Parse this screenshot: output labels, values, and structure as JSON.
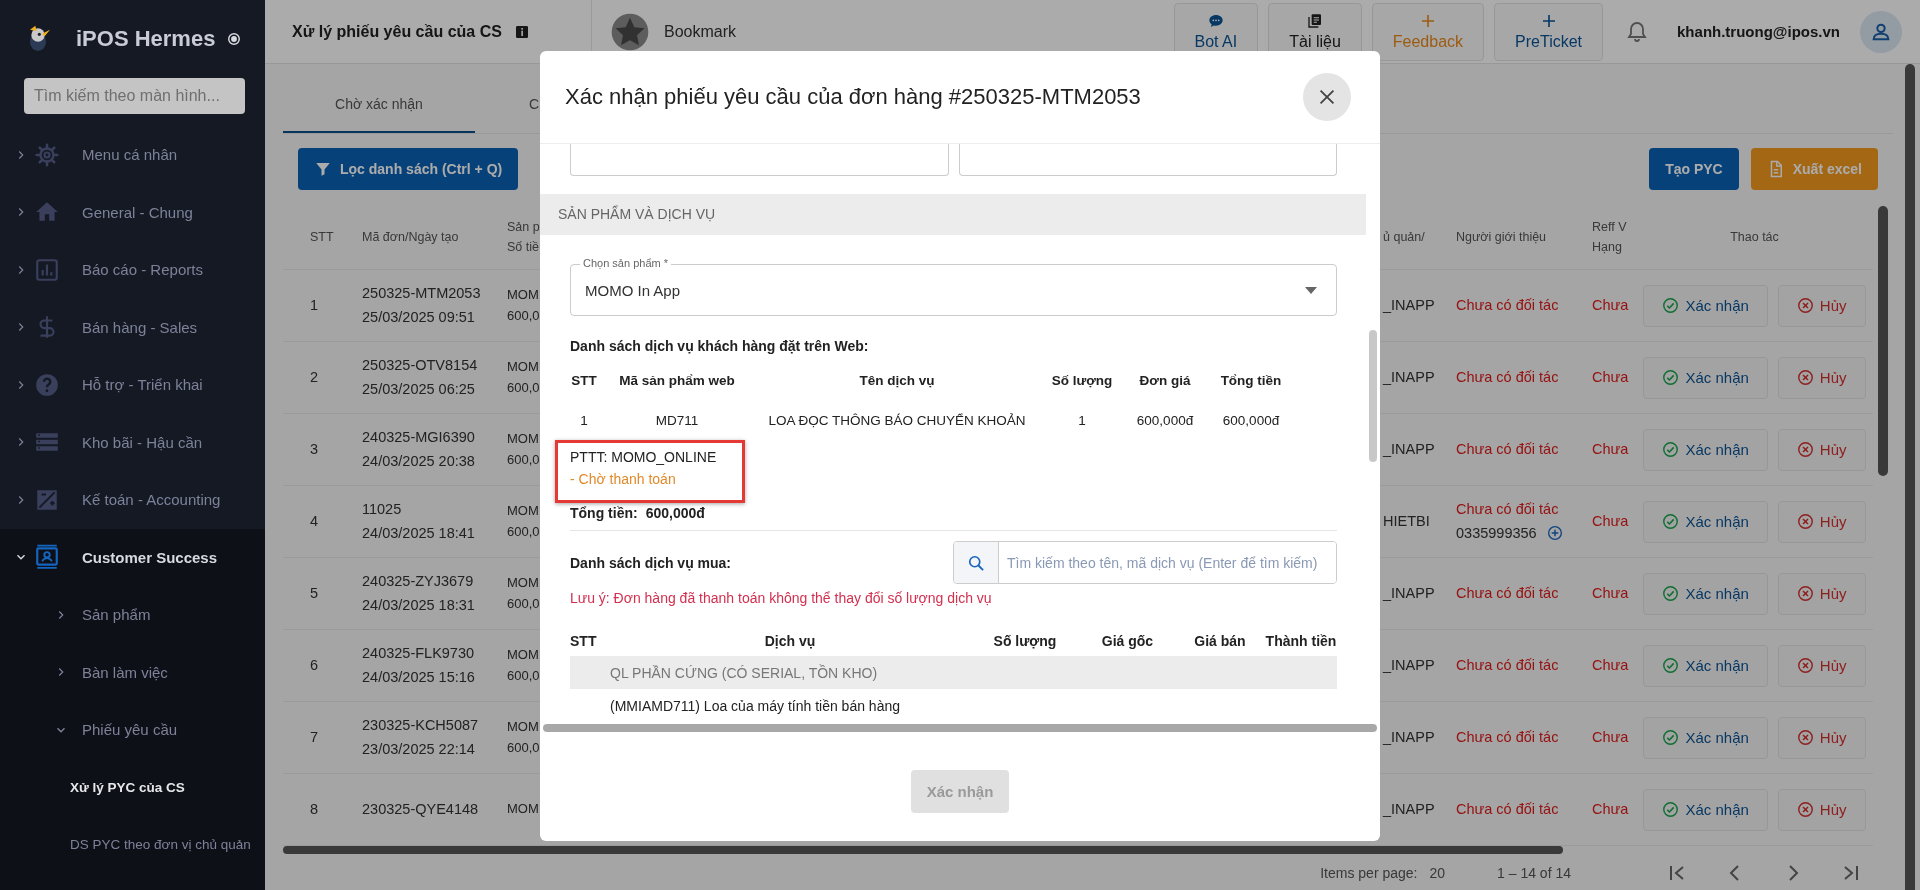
{
  "sidebar": {
    "brand": "iPOS Hermes",
    "search": {
      "placeholder": "Tìm kiếm theo màn hình..."
    },
    "items": [
      {
        "label": "Menu cá nhân",
        "expanded": false,
        "selected": false
      },
      {
        "label": "General - Chung",
        "expanded": false,
        "selected": false
      },
      {
        "label": "Báo cáo - Reports",
        "expanded": false,
        "selected": false
      },
      {
        "label": "Bán hàng - Sales",
        "expanded": false,
        "selected": false
      },
      {
        "label": "Hỗ trợ - Triển khai",
        "expanded": false,
        "selected": false
      },
      {
        "label": "Kho bãi - Hậu cần",
        "expanded": false,
        "selected": false
      },
      {
        "label": "Kế toán - Accounting",
        "expanded": false,
        "selected": false
      },
      {
        "label": "Customer Success",
        "expanded": true,
        "selected": false,
        "children": [
          {
            "label": "Sản phẩm",
            "expanded": false,
            "selected": false
          },
          {
            "label": "Bàn làm việc",
            "expanded": false,
            "selected": false
          },
          {
            "label": "Phiếu yêu cầu",
            "expanded": true,
            "selected": false,
            "children": [
              {
                "label": "Xử lý PYC của CS",
                "selected": true
              },
              {
                "label": "DS PYC theo đơn vị chủ quản",
                "selected": false
              }
            ]
          }
        ]
      }
    ]
  },
  "header": {
    "title": "Xử lý phiếu yêu cầu của CS",
    "bookmark": "Bookmark",
    "actions": [
      {
        "label": "Bot AI",
        "kind": "assistant"
      },
      {
        "label": "Tài liệu",
        "kind": "docs"
      },
      {
        "label": "Feedback",
        "kind": "feedback"
      },
      {
        "label": "PreTicket",
        "kind": "ticket"
      }
    ],
    "user": "khanh.truong@ipos.vn"
  },
  "tabs": [
    {
      "label": "Chờ xác nhận",
      "selected": true
    },
    {
      "label": "C",
      "selected": false
    }
  ],
  "toolbar": {
    "filter_button": "Lọc danh sách (Ctrl + Q)",
    "create_button": "Tạo PYC",
    "export_button": "Xuất excel"
  },
  "table": {
    "columns": [
      [
        "STT"
      ],
      [
        "Mã đơn/Ngày tạo"
      ],
      [
        "Sản p",
        "Số tiề"
      ],
      [
        "ủ quản/"
      ],
      [
        "Người giới thiệu"
      ],
      [
        "Reff V",
        "Hạng"
      ],
      [
        "Thao tác"
      ]
    ],
    "rows": [
      {
        "stt": "1",
        "code": "250325-MTM2053",
        "created": "25/03/2025 09:51",
        "column_3": [
          "MOM",
          "600,0"
        ],
        "column_4": "_INAPP",
        "referrer": "Chưa có đối tác",
        "reff": "Chưa",
        "actions": [
          "Xác nhận",
          "Hủy"
        ]
      },
      {
        "stt": "2",
        "code": "250325-OTV8154",
        "created": "25/03/2025 06:25",
        "column_3": [
          "MOM",
          "600,0"
        ],
        "column_4": "_INAPP",
        "referrer": "Chưa có đối tác",
        "reff": "Chưa",
        "actions": [
          "Xác nhận",
          "Hủy"
        ]
      },
      {
        "stt": "3",
        "code": "240325-MGI6390",
        "created": "24/03/2025 20:38",
        "column_3": [
          "MOM",
          "600,0"
        ],
        "column_4": "_INAPP",
        "referrer": "Chưa có đối tác",
        "reff": "Chưa",
        "actions": [
          "Xác nhận",
          "Hủy"
        ]
      },
      {
        "stt": "4",
        "code": "11025",
        "created": "24/03/2025 18:41",
        "column_3": [
          "MOM",
          "600,0"
        ],
        "column_4": "HIETBI",
        "referrer": "Chưa có đối tác",
        "referrer_phone": "0335999356",
        "reff": "Chưa",
        "actions": [
          "Xác nhận",
          "Hủy"
        ]
      },
      {
        "stt": "5",
        "code": "240325-ZYJ3679",
        "created": "24/03/2025 18:31",
        "column_3": [
          "MOM",
          "600,0"
        ],
        "column_4": "_INAPP",
        "referrer": "Chưa có đối tác",
        "reff": "Chưa",
        "actions": [
          "Xác nhận",
          "Hủy"
        ]
      },
      {
        "stt": "6",
        "code": "240325-FLK9730",
        "created": "24/03/2025 15:16",
        "column_3": [
          "MOM",
          "600,0"
        ],
        "column_4": "_INAPP",
        "referrer": "Chưa có đối tác",
        "reff": "Chưa",
        "actions": [
          "Xác nhận",
          "Hủy"
        ]
      },
      {
        "stt": "7",
        "code": "230325-KCH5087",
        "created": "23/03/2025 22:14",
        "column_3": [
          "MOM",
          "600,0"
        ],
        "column_4": "_INAPP",
        "referrer": "Chưa có đối tác",
        "reff": "Chưa",
        "actions": [
          "Xác nhận",
          "Hủy"
        ]
      },
      {
        "stt": "8",
        "code": "230325-QYE4148",
        "column_3": [
          "MOM"
        ],
        "column_4": "_INAPP",
        "referrer": "Chưa có đối tác",
        "reff": "Chưa",
        "actions": [
          "Xác nhận",
          "Hủy"
        ]
      }
    ]
  },
  "pagination": {
    "label": "Items per page:",
    "page_size": "20",
    "range": "1 – 14 of 14"
  },
  "dialog": {
    "title": "Xác nhận phiếu yêu cầu của đơn hàng #250325-MTM2053",
    "section": "SẢN PHẨM VÀ DỊCH VỤ",
    "product_select": {
      "label": "Chọn sản phẩm *",
      "value": "MOMO In App"
    },
    "web_services": {
      "title": "Danh sách dịch vụ khách hàng đặt trên Web:",
      "columns": [
        "STT",
        "Mã sản phẩm web",
        "Tên dịch vụ",
        "Số lượng",
        "Đơn giá",
        "Tổng tiền"
      ],
      "rows": [
        [
          "1",
          "MD711",
          "LOA ĐỌC THÔNG BÁO CHUYỂN KHOẢN",
          "1",
          "600,000đ",
          "600,000đ"
        ]
      ]
    },
    "payment": {
      "method": "PTTT: MOMO_ONLINE",
      "status": "- Chờ thanh toán"
    },
    "total": {
      "label": "Tổng tiền:",
      "value": "600,000đ"
    },
    "purchased": {
      "title": "Danh sách dịch vụ mua:",
      "search": {
        "placeholder": "Tìm kiếm theo tên, mã dịch vụ (Enter để tìm kiếm)"
      },
      "note": "Lưu ý: Đơn hàng đã thanh toán không thể thay đổi số lượng dịch vụ",
      "columns": [
        "STT",
        "Dịch vụ",
        "Số lượng",
        "Giá gốc",
        "Giá bán",
        "Thành tiền"
      ],
      "groups": [
        {
          "name": "QL PHẦN CỨNG (CÓ SERIAL, TỒN KHO)",
          "items": [
            "(MMIAMD711) Loa của máy tính tiền bán hàng"
          ]
        }
      ]
    },
    "confirm_button": {
      "label": "Xác nhận",
      "disabled": true
    }
  }
}
